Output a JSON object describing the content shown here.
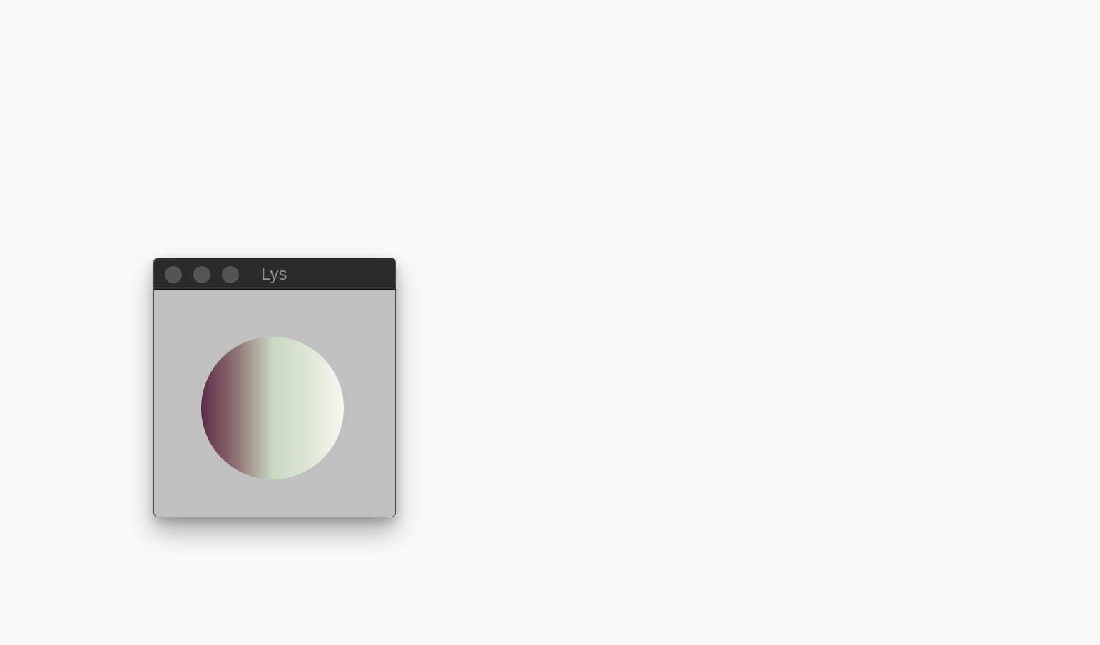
{
  "window": {
    "title": "Lys"
  },
  "colors": {
    "desktop_background": "#f9f9f9",
    "titlebar": "#2b2b2b",
    "window_content": "#c0c0c0",
    "traffic_light": "#545454",
    "title_text": "#8f8f8f",
    "orb_gradient": [
      "#5d2c46",
      "#8f7475",
      "#c8d7bf",
      "#dfe5d7",
      "#f6f6f0"
    ]
  },
  "icons": {
    "close": "close-button-icon",
    "minimize": "minimize-button-icon",
    "zoom": "zoom-button-icon"
  }
}
